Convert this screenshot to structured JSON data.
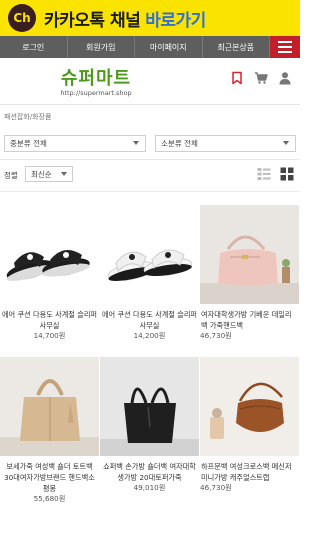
{
  "kakao": {
    "badge": "Ch",
    "title": "카카오톡 채널",
    "action": "바로가기",
    "bg_color": "#fbe300"
  },
  "nav": {
    "items": [
      "로그인",
      "회원가입",
      "마이페이지",
      "최근본상품"
    ],
    "menu_icon": "hamburger-icon",
    "menu_color": "#c0202a",
    "bar_color": "#5e5e5e"
  },
  "brand": {
    "logo_text": "슈퍼마트",
    "logo_url": "http://supermart.shop",
    "logo_color": "#4e9a1e",
    "icons": [
      "bookmark-icon",
      "cart-icon",
      "user-icon"
    ]
  },
  "breadcrumb": "패션잡화/화장품",
  "filters": {
    "category_mid": "중분류 전체",
    "category_small": "소분류 전체"
  },
  "sort": {
    "label": "정렬",
    "value": "최신순",
    "view_icons": [
      "list-view-icon",
      "grid-view-icon"
    ]
  },
  "products": [
    {
      "name": "에어 쿠션 다용도 사계절 슬리퍼 사무실",
      "price": "14,700원"
    },
    {
      "name": "에어 쿠션 다용도 사계절 슬리퍼 사무실",
      "price": "14,200원"
    },
    {
      "name": "여자대학생가방 기베운 데일리백 가죽핸드백",
      "price": "46,730원"
    },
    {
      "name": "보세가죽 여성백 숄더 토트백 30대여자가방브랜드 핸드백소평봉",
      "price": "55,680원"
    },
    {
      "name": "쇼퍼백 손가방 숄더백 여자대학생가방 20대토퍼가죽",
      "price": "49,010원"
    },
    {
      "name": "하프문백 여성크로스백 메신저 미니가방 캐주얼스트랩",
      "price": "46,730원"
    }
  ]
}
